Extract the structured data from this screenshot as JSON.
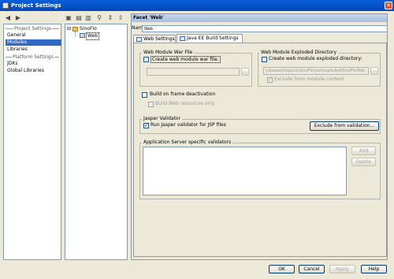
{
  "window": {
    "title": "Project Settings",
    "close_glyph": "✕"
  },
  "sidebar": {
    "project_settings_header": "Project Settings",
    "project_items": [
      "General",
      "Modules",
      "Libraries"
    ],
    "platform_settings_header": "Platform Settings",
    "platform_items": [
      "JDKs",
      "Global Libraries"
    ],
    "selected_item": "Modules"
  },
  "tree": {
    "root_label": "SinoFlo",
    "child_label": "Web",
    "expander": "⊟"
  },
  "facet": {
    "header": "Facet 'Web'",
    "name_label": "Name:",
    "name_value": "Web",
    "tabs": [
      "Web Settings",
      "Java EE Build Settings"
    ],
    "active_tab": "Java EE Build Settings"
  },
  "war_group": {
    "title": "Web Module War File",
    "create_label": "Create web module war file.",
    "create_checked": false,
    "path_value": "",
    "browse_label": "..."
  },
  "exploded_group": {
    "title": "Web Module Exploded Directory",
    "create_label": "Create web module exploded directory:",
    "create_checked": false,
    "path_value": "ydsasworkspace\\SinoFlo\\out\\exploded\\SinoFloWeb",
    "browse_label": "...",
    "exclude_label": "Exclude from module content",
    "exclude_checked": true
  },
  "frame_deactivation": {
    "build_label": "Build on frame deactivation",
    "build_checked": false,
    "build_web_label": "Build Web resources only",
    "build_web_checked": false
  },
  "jasper": {
    "title": "Jasper Validator",
    "run_label": "Run Jasper validator for JSP files",
    "run_checked": true,
    "exclude_button": "Exclude from validation..."
  },
  "validators": {
    "title": "Application Server specific validators",
    "add_button": "Add",
    "delete_button": "Delete"
  },
  "footer": {
    "ok": "OK",
    "cancel": "Cancel",
    "apply": "Apply",
    "help": "Help"
  },
  "toolbar": {
    "icons": [
      "back-icon",
      "forward-icon",
      "new-module-icon",
      "new-folder-icon",
      "delete-icon",
      "find-icon",
      "expand-all-icon",
      "collapse-all-icon"
    ]
  }
}
